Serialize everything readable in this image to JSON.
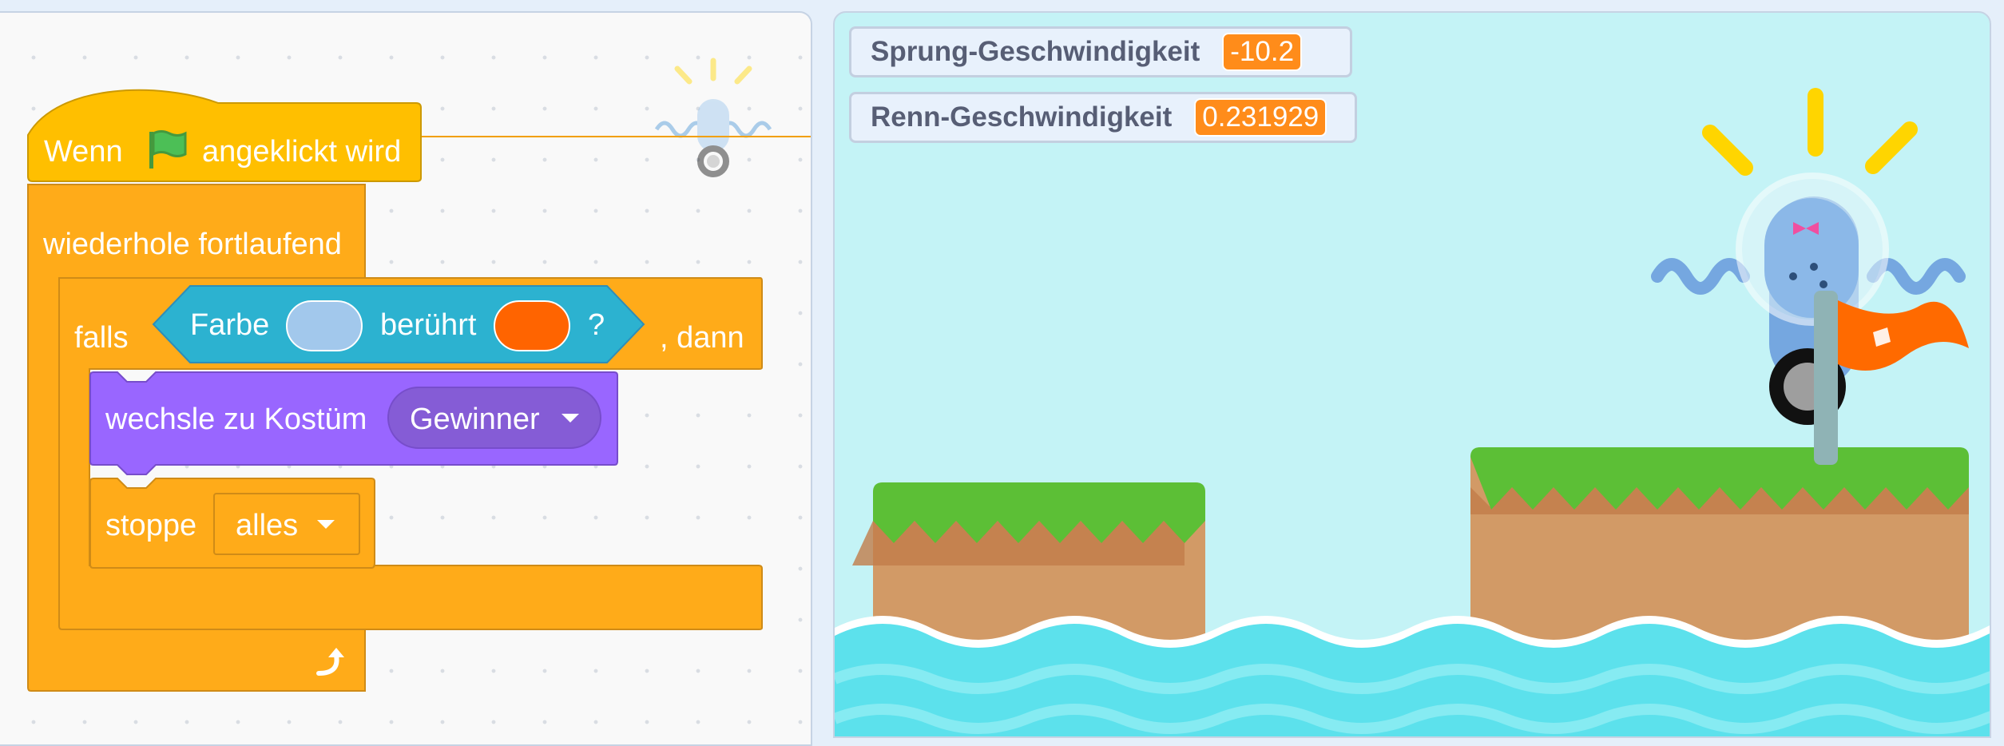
{
  "code": {
    "hat": {
      "when": "Wenn",
      "clicked": "angeklickt wird",
      "flag_icon": "green-flag-icon"
    },
    "forever": {
      "label": "wiederhole fortlaufend",
      "arrow_icon": "loop-arrow-icon"
    },
    "if_block": {
      "if": "falls",
      "then": ", dann"
    },
    "sensing": {
      "color": "Farbe",
      "touching": "berührt",
      "question": "?",
      "color1": "#a2c8ec",
      "color2": "#ff6400"
    },
    "looks": {
      "label": "wechsle zu Kostüm",
      "costume": "Gewinner"
    },
    "stop": {
      "label": "stoppe",
      "option": "alles"
    },
    "colors": {
      "events": "#ffbf00",
      "control": "#ffab19",
      "sensing": "#2cb2d0",
      "looks": "#9966ff"
    }
  },
  "stage": {
    "monitors": [
      {
        "label": "Sprung-Geschwindigkeit",
        "value": "-10.2"
      },
      {
        "label": "Renn-Geschwindigkeit",
        "value": "0.231929"
      }
    ]
  }
}
